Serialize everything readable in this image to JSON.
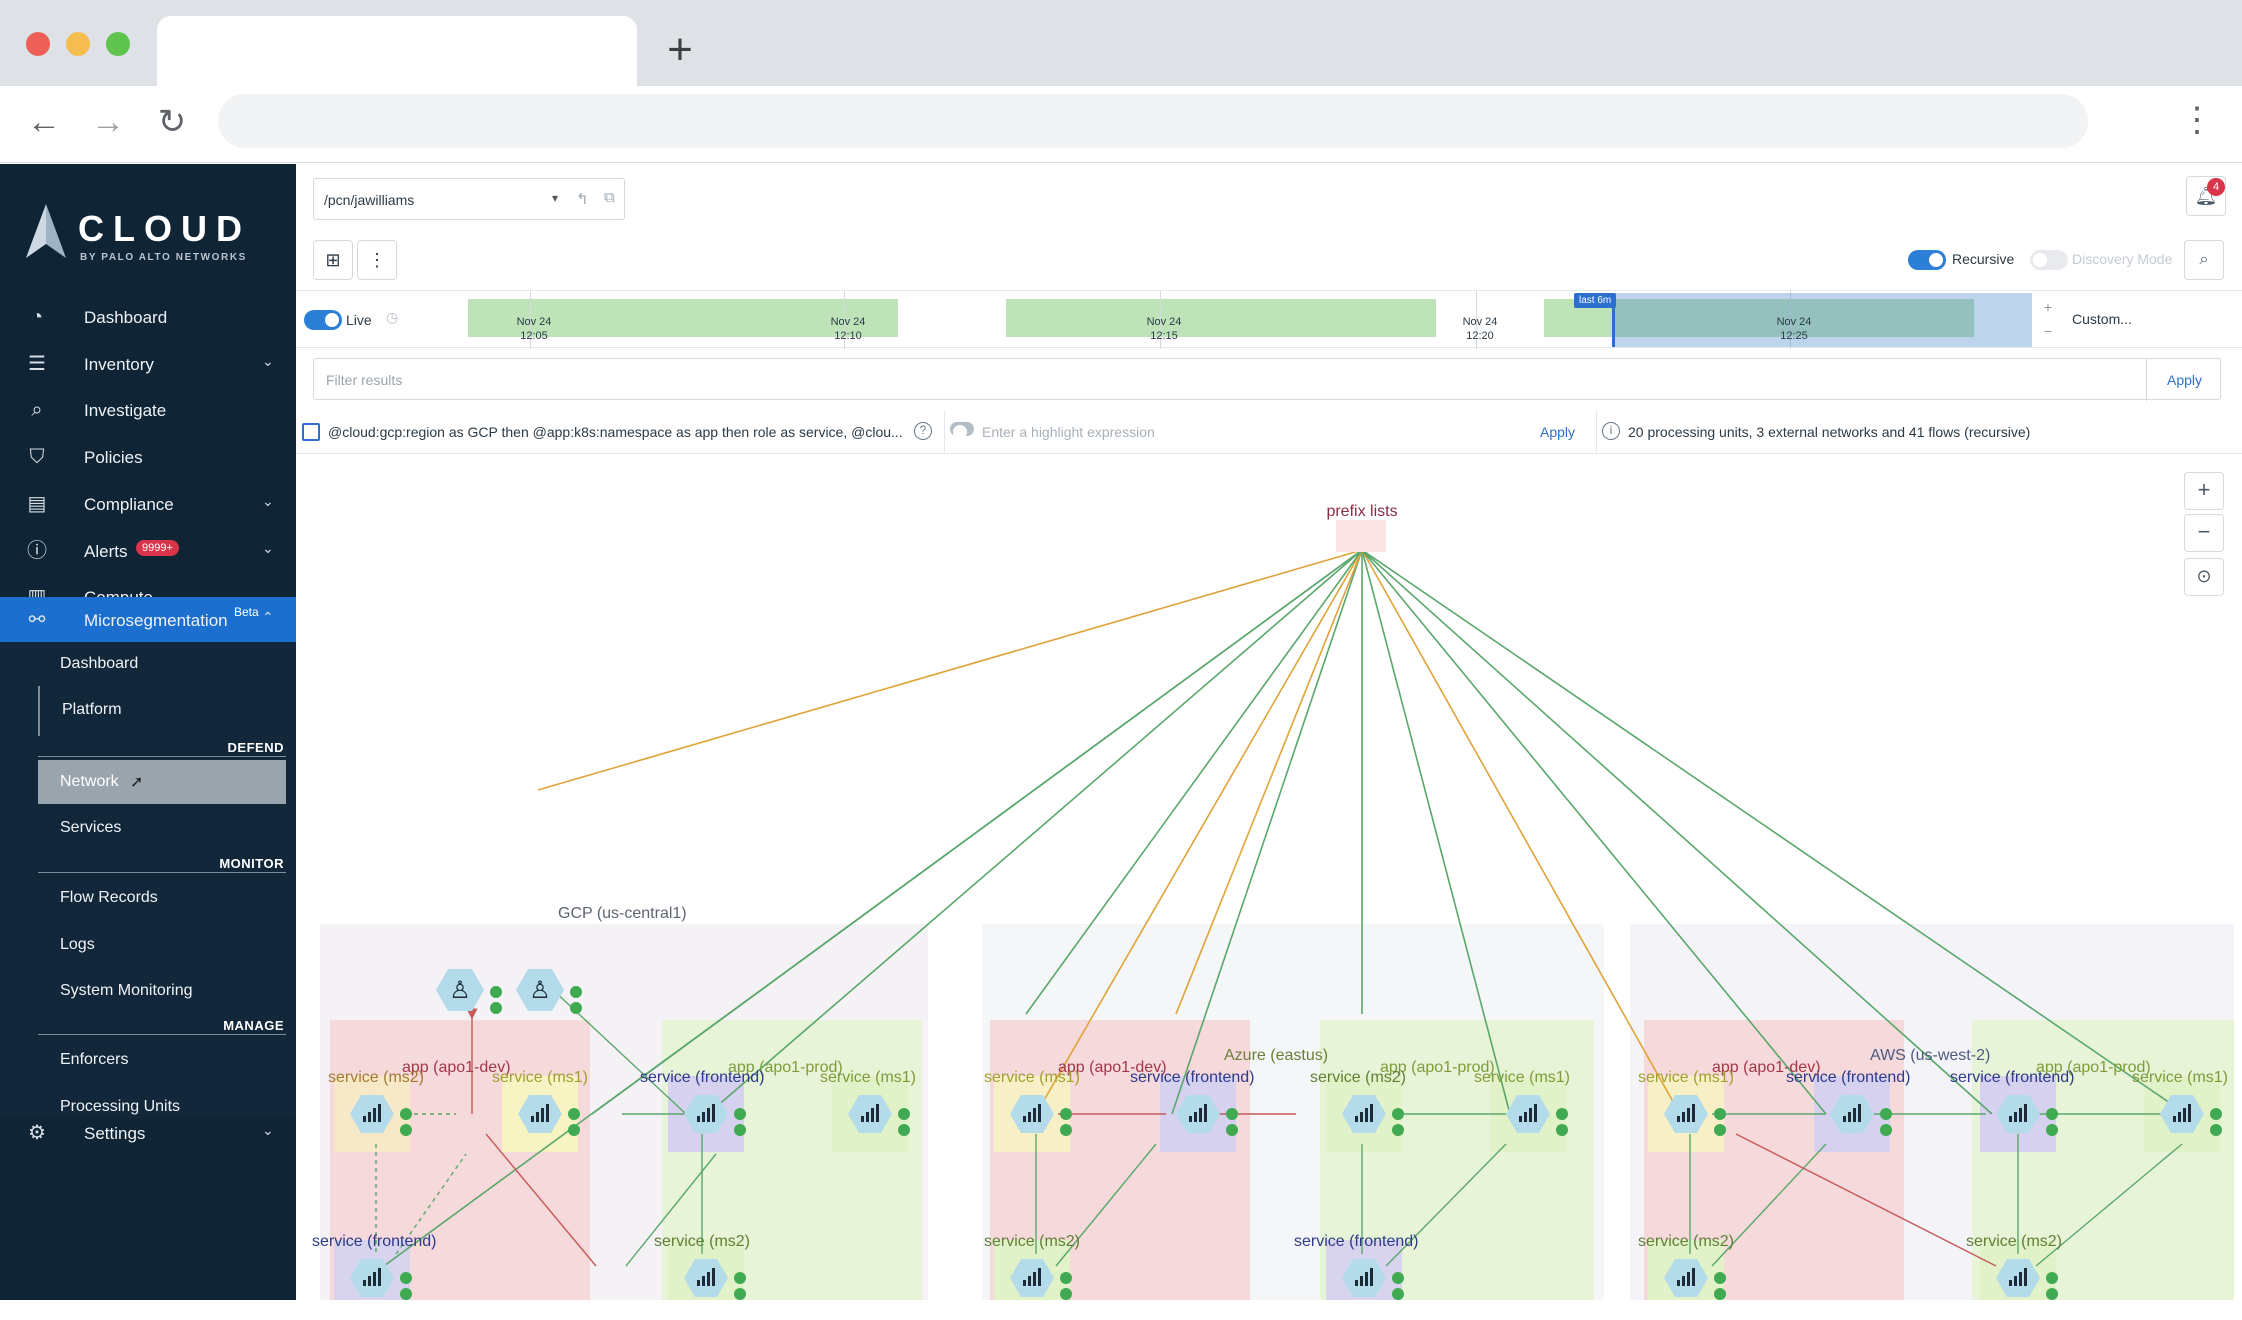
{
  "brand": {
    "name": "CLOUD",
    "sub": "BY PALO ALTO NETWORKS"
  },
  "sidebar": {
    "items": [
      {
        "label": "Dashboard"
      },
      {
        "label": "Inventory"
      },
      {
        "label": "Investigate"
      },
      {
        "label": "Policies"
      },
      {
        "label": "Compliance"
      },
      {
        "label": "Alerts",
        "badge": "9999+"
      },
      {
        "label": "Compute"
      },
      {
        "label": "Microsegmentation",
        "badge": "Beta"
      }
    ],
    "sub": {
      "dashboard": "Dashboard",
      "platform": "Platform",
      "defend_head": "DEFEND",
      "network": "Network",
      "services": "Services",
      "monitor_head": "MONITOR",
      "flow_records": "Flow Records",
      "logs": "Logs",
      "system_monitoring": "System Monitoring",
      "manage_head": "MANAGE",
      "enforcers": "Enforcers",
      "processing_units": "Processing Units"
    },
    "settings": "Settings"
  },
  "header": {
    "namespace": "/pcn/jawilliams",
    "notifications": "4",
    "recursive": "Recursive",
    "discovery_mode": "Discovery Mode"
  },
  "timeline": {
    "live": "Live",
    "labels": [
      {
        "d": "Nov 24",
        "t": "12:05"
      },
      {
        "d": "Nov 24",
        "t": "12:10"
      },
      {
        "d": "Nov 24",
        "t": "12:15"
      },
      {
        "d": "Nov 24",
        "t": "12:20"
      },
      {
        "d": "Nov 24",
        "t": "12:25"
      }
    ],
    "selection": "last 6m",
    "custom": "Custom..."
  },
  "filter": {
    "placeholder": "Filter results",
    "apply": "Apply"
  },
  "expression": {
    "text": "@cloud:gcp:region as GCP then @app:k8s:namespace as app then role as service, @clou...",
    "help": "?",
    "highlight_placeholder": "Enter a highlight expression",
    "apply": "Apply",
    "info": "20 processing units, 3 external networks and 41 flows (recursive)"
  },
  "graph": {
    "top": "prefix lists",
    "clouds": [
      "GCP (us-central1)",
      "Azure (eastus)",
      "AWS (us-west-2)"
    ],
    "apps": [
      "app (apo1-dev)",
      "app (apo1-prod)"
    ],
    "services": {
      "ms1": "service (ms1)",
      "ms2": "service (ms2)",
      "frontend": "service (frontend)"
    }
  },
  "colors": {
    "sidebar": "#0f2434",
    "accent": "#1c6fce",
    "flow_green": "#5aa76b",
    "flow_orange": "#e0a33a",
    "flow_red": "#c65a5a"
  }
}
